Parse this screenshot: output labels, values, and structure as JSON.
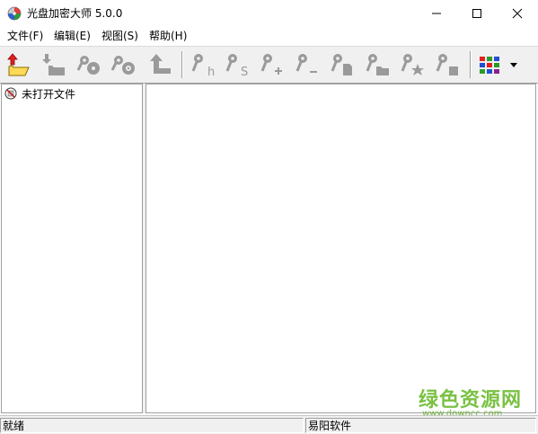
{
  "window": {
    "title": "光盘加密大师 5.0.0",
    "controls": {
      "minimize": "minimize-icon",
      "maximize": "maximize-icon",
      "close": "close-icon"
    }
  },
  "menu": {
    "items": [
      {
        "label": "文件(F)"
      },
      {
        "label": "编辑(E)"
      },
      {
        "label": "视图(S)"
      },
      {
        "label": "帮助(H)"
      }
    ]
  },
  "toolbar": {
    "buttons": [
      {
        "icon": "open-folder-icon",
        "enabled": true
      },
      {
        "icon": "import-icon",
        "enabled": false
      },
      {
        "icon": "key-disc-icon",
        "enabled": false
      },
      {
        "icon": "key-disc-alt-icon",
        "enabled": false
      },
      {
        "icon": "upload-icon",
        "enabled": false
      },
      {
        "icon": "key-h-icon",
        "enabled": false,
        "suffix": "h"
      },
      {
        "icon": "key-s-icon",
        "enabled": false,
        "suffix": "S"
      },
      {
        "icon": "key-add-icon",
        "enabled": false,
        "suffix": "+"
      },
      {
        "icon": "key-remove-icon",
        "enabled": false,
        "suffix": "−"
      },
      {
        "icon": "key-file-icon",
        "enabled": false
      },
      {
        "icon": "key-folder-icon",
        "enabled": false
      },
      {
        "icon": "key-star-icon",
        "enabled": false
      },
      {
        "icon": "key-stop-icon",
        "enabled": false
      },
      {
        "icon": "color-grid-icon",
        "enabled": true
      },
      {
        "icon": "dropdown-arrow-icon",
        "enabled": true
      }
    ]
  },
  "tree": {
    "items": [
      {
        "label": "未打开文件",
        "icon": "no-file-icon"
      }
    ]
  },
  "status": {
    "left": "就绪",
    "right": "易阳软件"
  },
  "watermark": {
    "text": "绿色资源网",
    "url": "www.downcc.com"
  },
  "colors": {
    "chrome": "#f0f0f0",
    "disabled_icon": "#9a9a9a",
    "watermark": "#7ac143"
  }
}
